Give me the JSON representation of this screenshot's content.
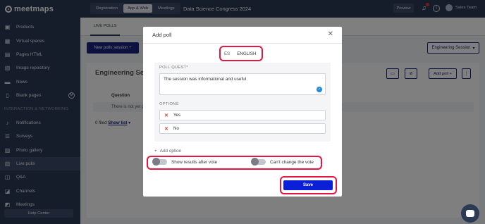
{
  "app": {
    "logo_text": "meetmaps"
  },
  "sidebar": {
    "items": [
      {
        "label": "Products",
        "icon": "box-icon"
      },
      {
        "label": "Virtual spaces",
        "icon": "building-icon"
      },
      {
        "label": "Pages HTML",
        "icon": "code-icon"
      },
      {
        "label": "Image repository",
        "icon": "image-icon"
      },
      {
        "label": "News",
        "icon": "news-icon"
      },
      {
        "label": "Blank pages",
        "icon": "page-icon",
        "badge": "M"
      }
    ],
    "section_label": "INTERACTION & NETWORKING",
    "interaction_items": [
      {
        "label": "Notifications",
        "icon": "bell-icon"
      },
      {
        "label": "Surveys",
        "icon": "list-icon"
      },
      {
        "label": "Photo gallery",
        "icon": "photo-icon"
      },
      {
        "label": "Live polls",
        "icon": "poll-icon",
        "active": true
      },
      {
        "label": "Q&A",
        "icon": "chat-icon"
      },
      {
        "label": "Channels",
        "icon": "channel-icon"
      },
      {
        "label": "Meetings",
        "icon": "meeting-icon"
      }
    ],
    "help_label": "Help Center"
  },
  "topbar": {
    "tabs": [
      "Registration",
      "App & Web",
      "Meetings"
    ],
    "selected_tab": "App & Web",
    "event_title": "Data Science Congress 2024",
    "preview_label": "Preview",
    "user_name": "Sales Team"
  },
  "main": {
    "subtab_label": "LIVE POLLS",
    "new_session_label": "New polls session",
    "new_session_plus": "+",
    "session_select_label": "Engineering Session",
    "session_title": "Engineering Sess",
    "add_poll_label": "Add poll",
    "add_poll_plus": "+",
    "column_question": "Question",
    "empty_text": "There is not yet p",
    "files_count": "0 filed",
    "show_list_label": "Show list"
  },
  "modal": {
    "title": "Add poll",
    "languages": [
      "ES",
      "ENGLISH"
    ],
    "selected_language": "ENGLISH",
    "question_label": "POLL QUEST*",
    "question_value": "The session was informational and useful",
    "options_label": "OPTIONS",
    "options": [
      "Yes",
      "No"
    ],
    "add_option_label": "Add option",
    "add_option_plus": "+",
    "toggle_show_results_label": "Show results after vote",
    "toggle_cant_change_label": "Can't change the vote",
    "save_label": "Save"
  },
  "colors": {
    "sidebar_bg": "#2b3a55",
    "primary": "#1a237e",
    "save_button": "#0a1fd6",
    "highlight": "#e5163f",
    "delete_x": "#e53935"
  }
}
